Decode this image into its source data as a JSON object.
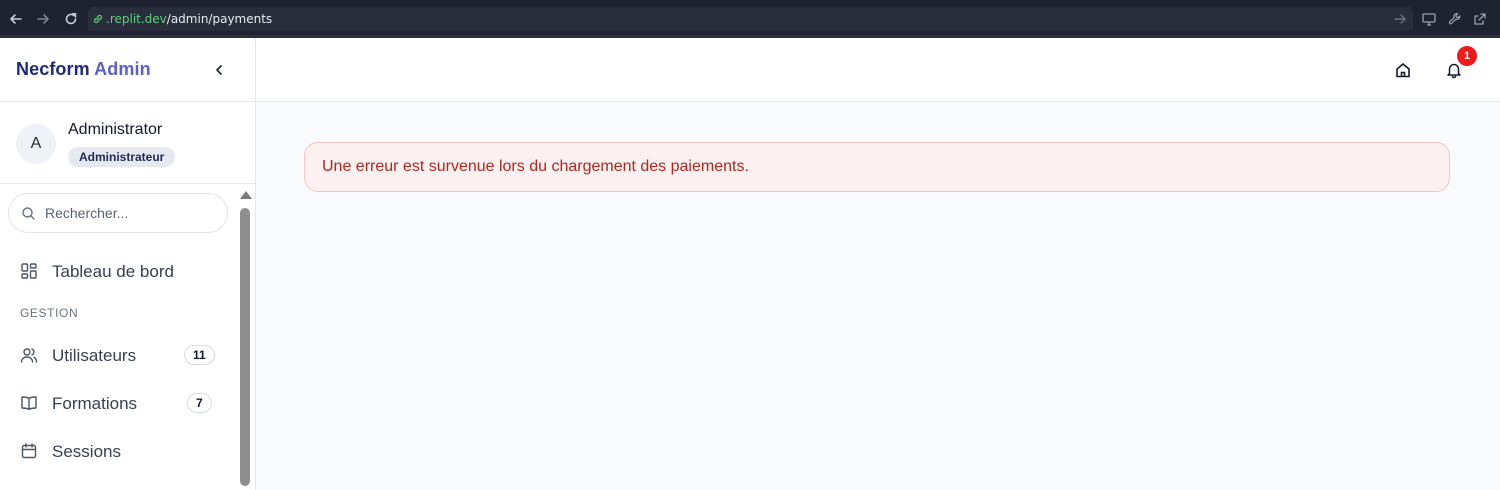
{
  "browser": {
    "url_host": ".replit.dev",
    "url_path": "/admin/payments"
  },
  "sidebar": {
    "brand_part1": "Necform",
    "brand_part2": "Admin",
    "user": {
      "avatar_initial": "A",
      "name": "Administrator",
      "role": "Administrateur"
    },
    "search_placeholder": "Rechercher...",
    "dashboard_label": "Tableau de bord",
    "section_label": "GESTION",
    "items": [
      {
        "label": "Utilisateurs",
        "count": "11",
        "icon": "users-icon"
      },
      {
        "label": "Formations",
        "count": "7",
        "icon": "book-icon"
      },
      {
        "label": "Sessions",
        "count": "",
        "icon": "calendar-icon"
      }
    ]
  },
  "header": {
    "notification_count": "1"
  },
  "main": {
    "error_message": "Une erreur est survenue lors du chargement des paiements."
  },
  "colors": {
    "brand_dark": "#1e2a78",
    "brand_accent": "#5b5fc7",
    "error_text": "#b3261e",
    "error_bg": "#fdf0f0",
    "badge_red": "#ef1b1b"
  }
}
